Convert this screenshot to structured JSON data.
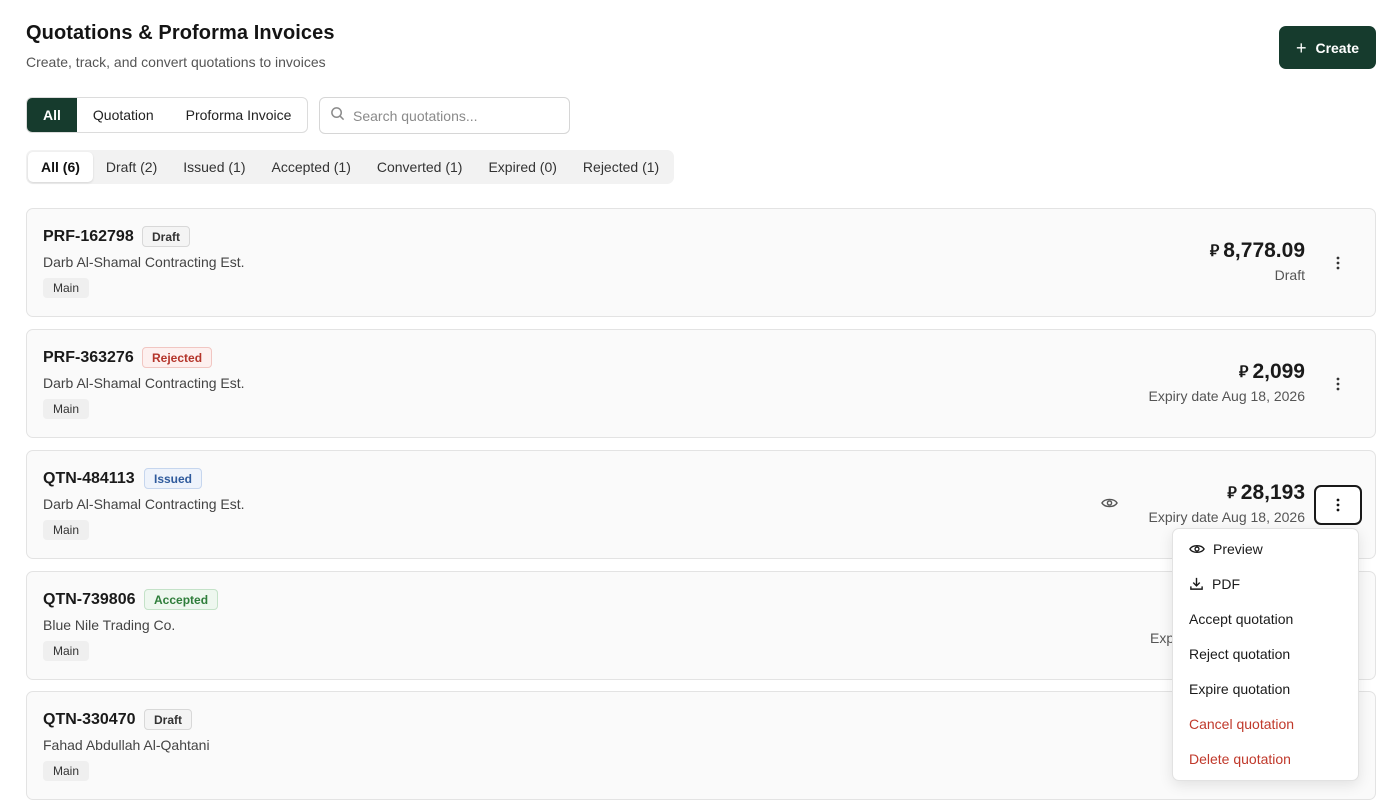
{
  "header": {
    "title": "Quotations & Proforma Invoices",
    "subtitle": "Create, track, and convert quotations to invoices",
    "create_label": "Create"
  },
  "type_tabs": [
    {
      "label": "All",
      "active": true
    },
    {
      "label": "Quotation",
      "active": false
    },
    {
      "label": "Proforma Invoice",
      "active": false
    }
  ],
  "search": {
    "placeholder": "Search quotations...",
    "value": ""
  },
  "status_tabs": [
    {
      "label": "All (6)",
      "active": true
    },
    {
      "label": "Draft (2)",
      "active": false
    },
    {
      "label": "Issued (1)",
      "active": false
    },
    {
      "label": "Accepted (1)",
      "active": false
    },
    {
      "label": "Converted (1)",
      "active": false
    },
    {
      "label": "Expired (0)",
      "active": false
    },
    {
      "label": "Rejected (1)",
      "active": false
    }
  ],
  "currency_symbol": "⃁",
  "cards": [
    {
      "id": "PRF-162798",
      "badge": "Draft",
      "badge_type": "draft",
      "client": "Darb Al-Shamal Contracting Est.",
      "branch": "Main",
      "amount": "8,778.09",
      "sub": "Draft"
    },
    {
      "id": "PRF-363276",
      "badge": "Rejected",
      "badge_type": "rejected",
      "client": "Darb Al-Shamal Contracting Est.",
      "branch": "Main",
      "amount": "2,099",
      "sub": "Expiry date Aug 18, 2026"
    },
    {
      "id": "QTN-484113",
      "badge": "Issued",
      "badge_type": "issued",
      "client": "Darb Al-Shamal Contracting Est.",
      "branch": "Main",
      "amount": "28,193",
      "sub": "Expiry date Aug 18, 2026"
    },
    {
      "id": "QTN-739806",
      "badge": "Accepted",
      "badge_type": "accepted",
      "client": "Blue Nile Trading Co.",
      "branch": "Main",
      "amount": "",
      "sub": "Exp"
    },
    {
      "id": "QTN-330470",
      "badge": "Draft",
      "badge_type": "draft",
      "client": "Fahad Abdullah Al-Qahtani",
      "branch": "Main",
      "amount": "",
      "sub": ""
    }
  ],
  "menu": [
    {
      "label": "Preview",
      "icon": "eye-icon",
      "danger": false
    },
    {
      "label": "PDF",
      "icon": "download-icon",
      "danger": false
    },
    {
      "label": "Accept quotation",
      "icon": "",
      "danger": false
    },
    {
      "label": "Reject quotation",
      "icon": "",
      "danger": false
    },
    {
      "label": "Expire quotation",
      "icon": "",
      "danger": false
    },
    {
      "label": "Cancel quotation",
      "icon": "",
      "danger": true
    },
    {
      "label": "Delete quotation",
      "icon": "",
      "danger": true
    }
  ]
}
